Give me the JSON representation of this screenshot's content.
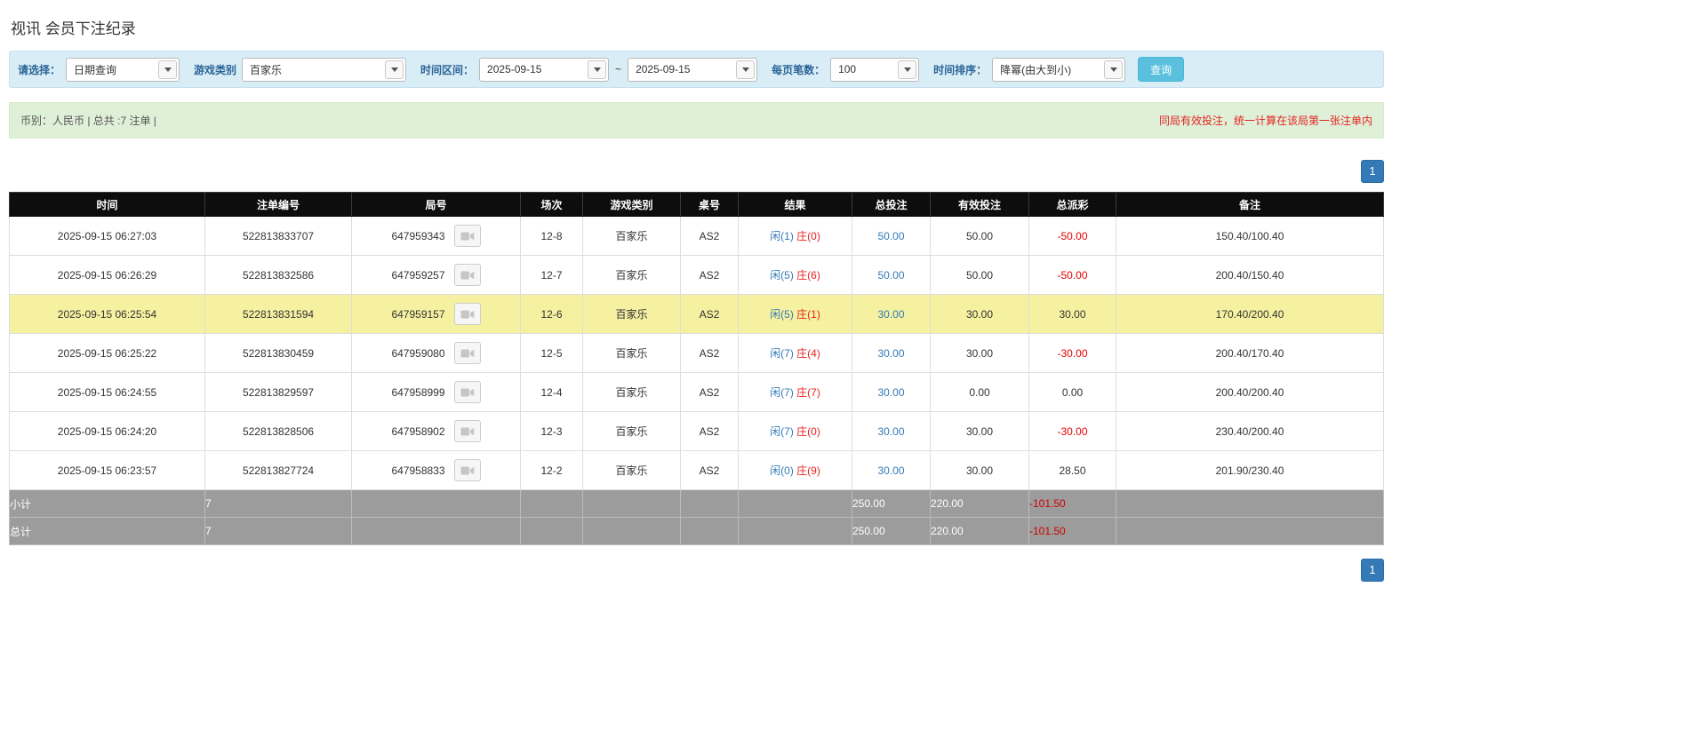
{
  "page": {
    "title": "视讯 会员下注纪录"
  },
  "filters": {
    "select_label": "请选择：",
    "select_value": "日期查询",
    "game_type_label": "游戏类别",
    "game_type_value": "百家乐",
    "date_range_label": "时间区间：",
    "date_from": "2025-09-15",
    "range_separator": "~",
    "date_to": "2025-09-15",
    "page_size_label": "每页笔数：",
    "page_size_value": "100",
    "sort_label": "时间排序：",
    "sort_value": "降幂(由大到小)",
    "search_button": "查询"
  },
  "summary": {
    "left": "币别：人民币 | 总共 :7 注单 |",
    "right": "同局有效投注，统一计算在该局第一张注单内"
  },
  "pagination": {
    "page": "1"
  },
  "table": {
    "headers": [
      "时间",
      "注单编号",
      "局号",
      "场次",
      "游戏类别",
      "桌号",
      "结果",
      "总投注",
      "有效投注",
      "总派彩",
      "备注"
    ],
    "rows": [
      {
        "time": "2025-09-15 06:27:03",
        "bet_id": "522813833707",
        "round": "647959343",
        "session": "12-8",
        "game": "百家乐",
        "table_no": "AS2",
        "result_player": "闲(1)",
        "result_banker": "庄(0)",
        "total_bet": "50.00",
        "valid_bet": "50.00",
        "payout": "-50.00",
        "note": "150.40/100.40",
        "highlight": false
      },
      {
        "time": "2025-09-15 06:26:29",
        "bet_id": "522813832586",
        "round": "647959257",
        "session": "12-7",
        "game": "百家乐",
        "table_no": "AS2",
        "result_player": "闲(5)",
        "result_banker": "庄(6)",
        "total_bet": "50.00",
        "valid_bet": "50.00",
        "payout": "-50.00",
        "note": "200.40/150.40",
        "highlight": false
      },
      {
        "time": "2025-09-15 06:25:54",
        "bet_id": "522813831594",
        "round": "647959157",
        "session": "12-6",
        "game": "百家乐",
        "table_no": "AS2",
        "result_player": "闲(5)",
        "result_banker": "庄(1)",
        "total_bet": "30.00",
        "valid_bet": "30.00",
        "payout": "30.00",
        "note": "170.40/200.40",
        "highlight": true
      },
      {
        "time": "2025-09-15 06:25:22",
        "bet_id": "522813830459",
        "round": "647959080",
        "session": "12-5",
        "game": "百家乐",
        "table_no": "AS2",
        "result_player": "闲(7)",
        "result_banker": "庄(4)",
        "total_bet": "30.00",
        "valid_bet": "30.00",
        "payout": "-30.00",
        "note": "200.40/170.40",
        "highlight": false
      },
      {
        "time": "2025-09-15 06:24:55",
        "bet_id": "522813829597",
        "round": "647958999",
        "session": "12-4",
        "game": "百家乐",
        "table_no": "AS2",
        "result_player": "闲(7)",
        "result_banker": "庄(7)",
        "total_bet": "30.00",
        "valid_bet": "0.00",
        "payout": "0.00",
        "note": "200.40/200.40",
        "highlight": false
      },
      {
        "time": "2025-09-15 06:24:20",
        "bet_id": "522813828506",
        "round": "647958902",
        "session": "12-3",
        "game": "百家乐",
        "table_no": "AS2",
        "result_player": "闲(7)",
        "result_banker": "庄(0)",
        "total_bet": "30.00",
        "valid_bet": "30.00",
        "payout": "-30.00",
        "note": "230.40/200.40",
        "highlight": false
      },
      {
        "time": "2025-09-15 06:23:57",
        "bet_id": "522813827724",
        "round": "647958833",
        "session": "12-2",
        "game": "百家乐",
        "table_no": "AS2",
        "result_player": "闲(0)",
        "result_banker": "庄(9)",
        "total_bet": "30.00",
        "valid_bet": "30.00",
        "payout": "28.50",
        "note": "201.90/230.40",
        "highlight": false
      }
    ],
    "subtotal": {
      "label": "小计",
      "count": "7",
      "total_bet": "250.00",
      "valid_bet": "220.00",
      "payout": "-101.50"
    },
    "total": {
      "label": "总计",
      "count": "7",
      "total_bet": "250.00",
      "valid_bet": "220.00",
      "payout": "-101.50"
    }
  }
}
